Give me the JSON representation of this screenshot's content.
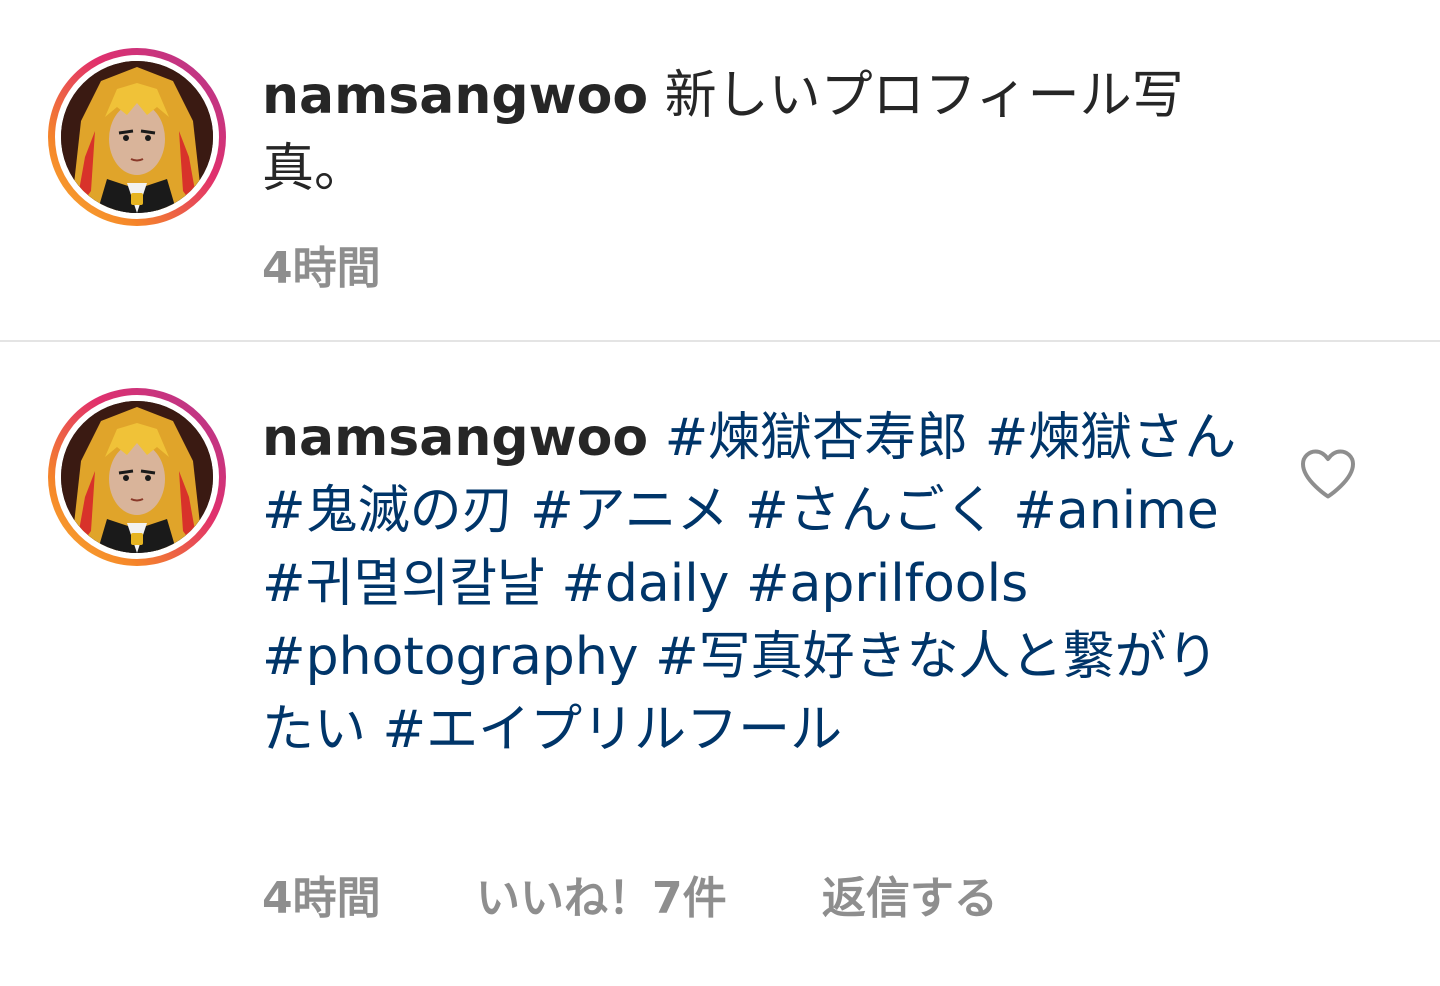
{
  "caption": {
    "username": "namsangwoo",
    "text": "新しいプロフィール写真。",
    "time": "4時間"
  },
  "comment": {
    "username": "namsangwoo",
    "hashtags": [
      "#煉獄杏寿郎",
      "#煉獄さん",
      "#鬼滅の刃",
      "#アニメ",
      "#さんごく",
      "#anime",
      "#귀멸의칼날",
      "#daily",
      "#aprilfools",
      "#photography",
      "#写真好きな人と繋がりたい",
      "#エイプリルフール"
    ],
    "time": "4時間",
    "likes": "いいね！7件",
    "reply": "返信する"
  },
  "icons": {
    "like": "heart-outline-icon"
  },
  "colors": {
    "hashtag": "#003569",
    "meta": "#8e8e8e",
    "text": "#262626",
    "divider": "#e4e4e4"
  }
}
